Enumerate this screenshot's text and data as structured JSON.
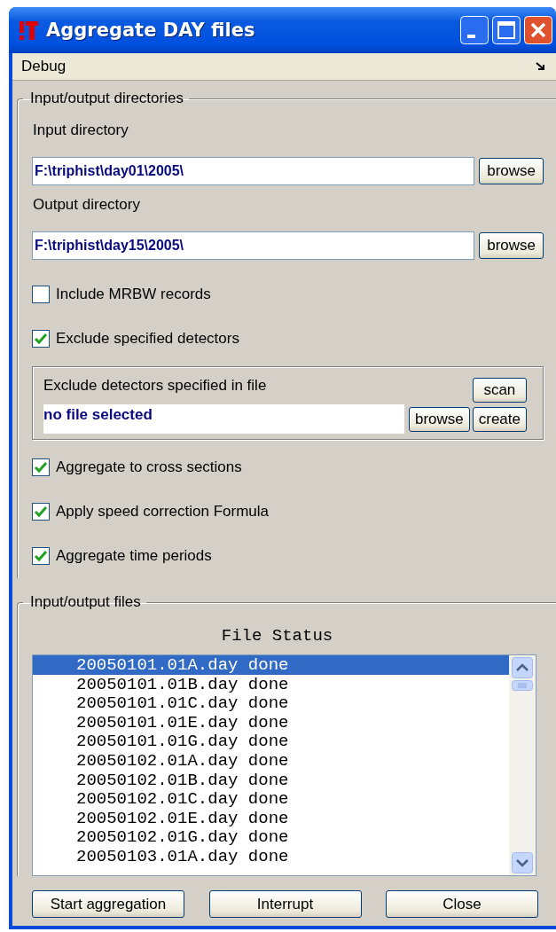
{
  "window": {
    "title": "Aggregate DAY files"
  },
  "menu": [
    {
      "label": "Debug"
    }
  ],
  "directories": {
    "title": "Input/output directories",
    "fields": [
      {
        "label": "Input directory",
        "value": "F:\\triphist\\day01\\2005\\",
        "button": "browse"
      },
      {
        "label": "Output directory",
        "value": "F:\\triphist\\day15\\2005\\",
        "button": "browse"
      }
    ],
    "options": [
      {
        "kind": "checkbox",
        "label": "Include MRBW records",
        "checked": false
      },
      {
        "kind": "checkbox",
        "label": "Exclude specified detectors",
        "checked": true
      },
      {
        "kind": "file-panel",
        "label": "Exclude detectors specified in file",
        "value": "no file selected",
        "buttons": [
          "scan",
          "browse",
          "create"
        ]
      },
      {
        "kind": "checkbox",
        "label": "Aggregate to cross sections",
        "checked": true
      },
      {
        "kind": "checkbox",
        "label": "Apply speed correction Formula",
        "checked": true
      },
      {
        "kind": "checkbox",
        "label": "Aggregate time periods",
        "checked": true
      }
    ]
  },
  "files": {
    "title": "Input/output files",
    "heading": "File Status",
    "rows": [
      {
        "file": "20050101.01A.day",
        "status": "done",
        "selected": true
      },
      {
        "file": "20050101.01B.day",
        "status": "done",
        "selected": false
      },
      {
        "file": "20050101.01C.day",
        "status": "done",
        "selected": false
      },
      {
        "file": "20050101.01E.day",
        "status": "done",
        "selected": false
      },
      {
        "file": "20050101.01G.day",
        "status": "done",
        "selected": false
      },
      {
        "file": "20050102.01A.day",
        "status": "done",
        "selected": false
      },
      {
        "file": "20050102.01B.day",
        "status": "done",
        "selected": false
      },
      {
        "file": "20050102.01C.day",
        "status": "done",
        "selected": false
      },
      {
        "file": "20050102.01E.day",
        "status": "done",
        "selected": false
      },
      {
        "file": "20050102.01G.day",
        "status": "done",
        "selected": false
      },
      {
        "file": "20050103.01A.day",
        "status": "done",
        "selected": false
      }
    ]
  },
  "buttons": [
    {
      "label": "Start aggregation"
    },
    {
      "label": "Interrupt"
    },
    {
      "label": "Close"
    }
  ]
}
